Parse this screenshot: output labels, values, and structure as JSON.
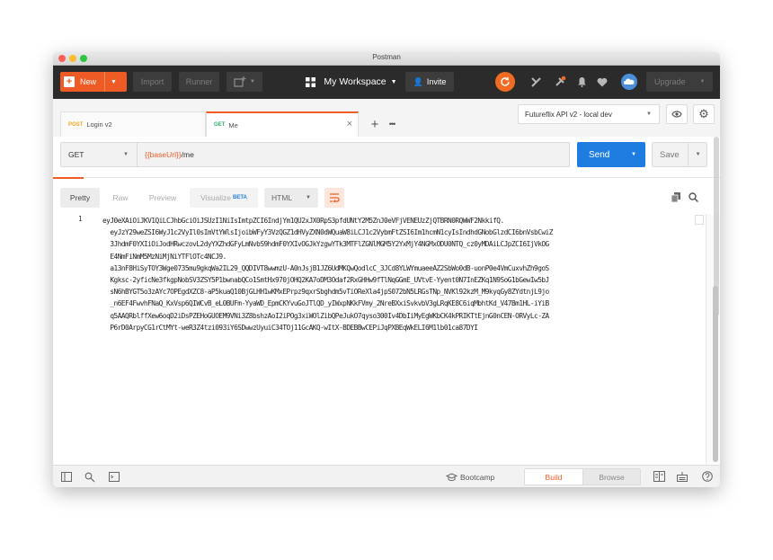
{
  "window": {
    "title": "Postman"
  },
  "header": {
    "new_label": "New",
    "import_label": "Import",
    "runner_label": "Runner",
    "workspace_label": "My Workspace",
    "invite_label": "Invite",
    "upgrade_label": "Upgrade"
  },
  "tabs": [
    {
      "method": "POST",
      "name": "Login v2",
      "method_color": "#f5a623"
    },
    {
      "method": "GET",
      "name": "Me",
      "method_color": "#2fae69"
    }
  ],
  "environment": {
    "selected": "Futureflix API v2 - local dev"
  },
  "request": {
    "method": "GET",
    "url": "{{baseUrl}}/me",
    "send_label": "Send",
    "save_label": "Save"
  },
  "response": {
    "view_tabs": [
      "Pretty",
      "Raw",
      "Preview",
      "Visualize"
    ],
    "beta_label": "BETA",
    "format": "HTML",
    "line_number": "1",
    "lines": [
      "eyJ0eXAiOiJKV1QiLCJhbGciOiJSUzI1NiIsImtpZCI6IndjYm1QU2xJX0RpS3pfdUNtY2M5ZnJ0eVFjVENEUzZjQTBRN0RQWWF2NkkifQ.",
      "  eyJzY29weZSI6WyJ1c2VyIl0sImVtYWlsIjoibWFyY3VzQGZ1dHVyZXN0dWQuaW8iLCJ1c2VybmFtZSI6Im1hcmN1cyIsIndhdGNobGlzdCI6bnVsbCwiZ",
      "  3JhdmF0YXIiOiJodHRwczovL2dyYXZhdGFyLmNvbS9hdmF0YXIvOGJkYzgwYTk3MTFlZGNlMGM5Y2YxMjY4NGMxODU0NTQ_cz0yMDAiLCJpZCI6IjVkOG",
      "  E4NmFiNmM5MzNiMjNiYTFlOTc4NCJ9.",
      "  a13nF8HiSyTOY3Wge0735mu9gkqWa2IL29_QQDIVT8wwmzU-A0nJsjB1JZ6UdMKQwQodlcC_3JCd8YLWYmuaeeAZ2SbWo0dB-uonP0e4VmCuxvhZh9goS",
      "  Kgksc-2yficNe3fkgpNobSV3ZSY5P1bwnabQCo1SmtHx970jOHQ2KA7oDM3Odaf2RxGHHw9fTlNqGGmE_UVtvE-Yyent0N7InEZKq1N9SoG1bGewIw5bJ",
      "  sN6hBYGT5o3zAYc7OPEgdXZC8-aP5kuaQ10BjGLHH1wKMxEPrpz9qxrSbghdm5vTiOReXla4jpS072bN5LRGsTNp_NVKl92kzM_M9kyqGy8ZYdtnjL9jo",
      "  _n6EF4FwvhFNaQ_KxVsp6QIWCvB_eL0BUFm-YyaWD_EpmCKYvuGoJTlQD_yIWxpNKkFVmy_2NreBXxiSvkvbV3gLRqKE8C6iqMbhtKd_V47Bm1HL-iYiB",
      "  q5AAQRblffXew6oqD2iDsPZEHoGUOEM9VNi3Z8bshzAoI2iPOg3xiWOlZibQPeJukO7qyso300Iv4DbIiMyEgWKbCK4kPRIKTtEjnG0nCEN-ORVyLc-ZA",
      "  P6rD0ArpyCG1rCtMYt-weR3Z4tzi093iY6SDwwzUyuiC34TOj11GcAKQ-wItX-BDEBBwCEPiJqPXBEqWkELI6M1lb01ca87DYI"
    ]
  },
  "footer": {
    "bootcamp_label": "Bootcamp",
    "build_label": "Build",
    "browse_label": "Browse"
  },
  "colors": {
    "accent_orange": "#ef5b25",
    "send_blue": "#1f7de1",
    "header_dark": "#2b2b2b"
  }
}
